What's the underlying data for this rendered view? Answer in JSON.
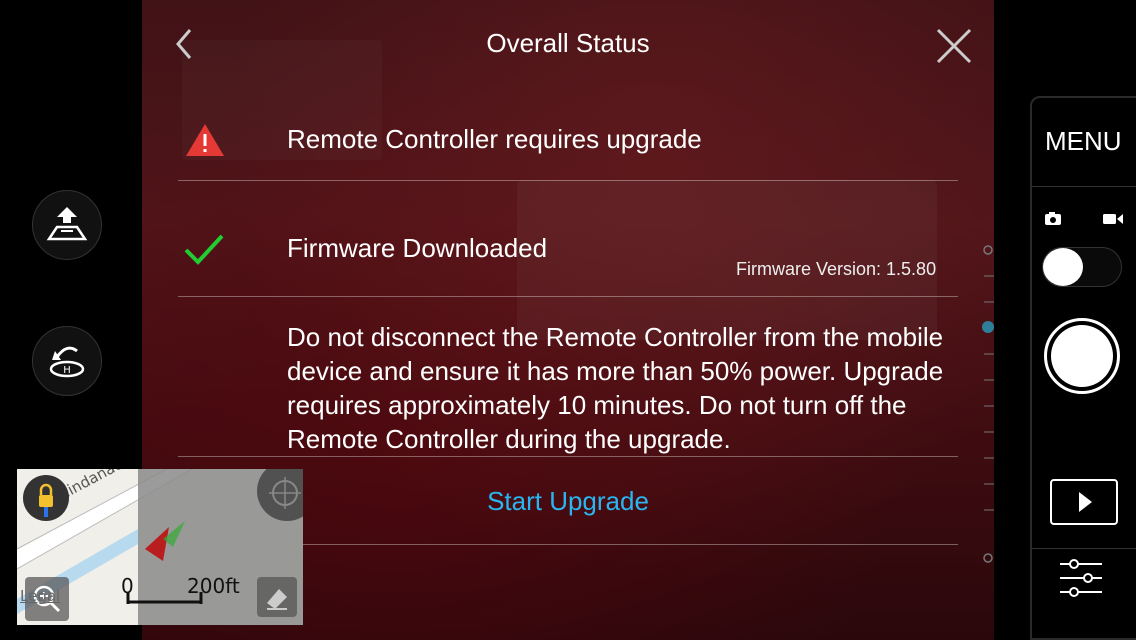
{
  "dialog": {
    "title": "Overall Status",
    "rows": [
      {
        "label": "Remote Controller requires upgrade",
        "icon": "warning-icon"
      },
      {
        "label": "Firmware Downloaded",
        "icon": "checkmark-icon"
      }
    ],
    "firmware_version": "Firmware Version: 1.5.80",
    "warning_message": "Do not disconnect the Remote Controller from the mobile device and ensure it has more than 50% power. Upgrade requires approximately 10 minutes. Do not turn off the Remote Controller during the upgrade.",
    "action_label": "Start Upgrade"
  },
  "right_panel": {
    "menu_label": "MENU",
    "mode_icons": [
      "camera-icon",
      "video-icon"
    ],
    "toggle_state": "photo"
  },
  "minimap": {
    "street_label": "Mindanao Way",
    "scale_start": "0",
    "scale_end": "200ft",
    "legal_label": "Legal"
  },
  "colors": {
    "accent": "#29b6f0",
    "warning": "#e53935",
    "success": "#22cc33"
  }
}
